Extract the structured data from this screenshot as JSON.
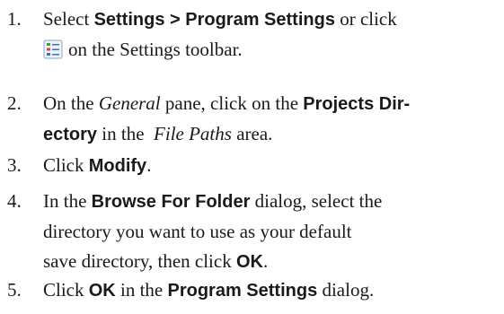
{
  "steps": [
    {
      "num": "1.",
      "lines": [
        {
          "a": "Select ",
          "ui1": "Settings > Program Settings",
          "b": " or click"
        },
        {
          "icon": "program-settings-icon",
          "c": "on the Settings toolbar."
        }
      ]
    },
    {
      "num": "2.",
      "lines": [
        {
          "a": "On the ",
          "em": "General",
          "b": " pane, click on the ",
          "ui1": "Projects Dir-"
        },
        {
          "ui1": "ectory",
          "a": " in the  ",
          "em": "File Paths",
          "b": " area."
        }
      ]
    },
    {
      "num": "3.",
      "lines": [
        {
          "a": "Click ",
          "ui1": "Modify",
          "b": "."
        }
      ]
    },
    {
      "num": "4.",
      "lines": [
        {
          "a": "In the ",
          "ui1": "Browse For Folder",
          "b": " dialog, select the"
        },
        {
          "a": "directory you want to use as your default"
        },
        {
          "a": "save directory, then click ",
          "ui1": "OK",
          "b": "."
        }
      ]
    },
    {
      "num": "5.",
      "lines": [
        {
          "a": "Click ",
          "ui1": "OK",
          "b": " in the ",
          "ui2": "Program Settings",
          "c": " dialog."
        }
      ]
    }
  ],
  "colors": {
    "text": "#1a1a1a",
    "icon_frame": "#8aa4c8",
    "icon_fill": "#eef3fb",
    "icon_accent_green": "#3aa24a",
    "icon_accent_red": "#d64a3a",
    "icon_accent_blue": "#3d6fc2"
  }
}
